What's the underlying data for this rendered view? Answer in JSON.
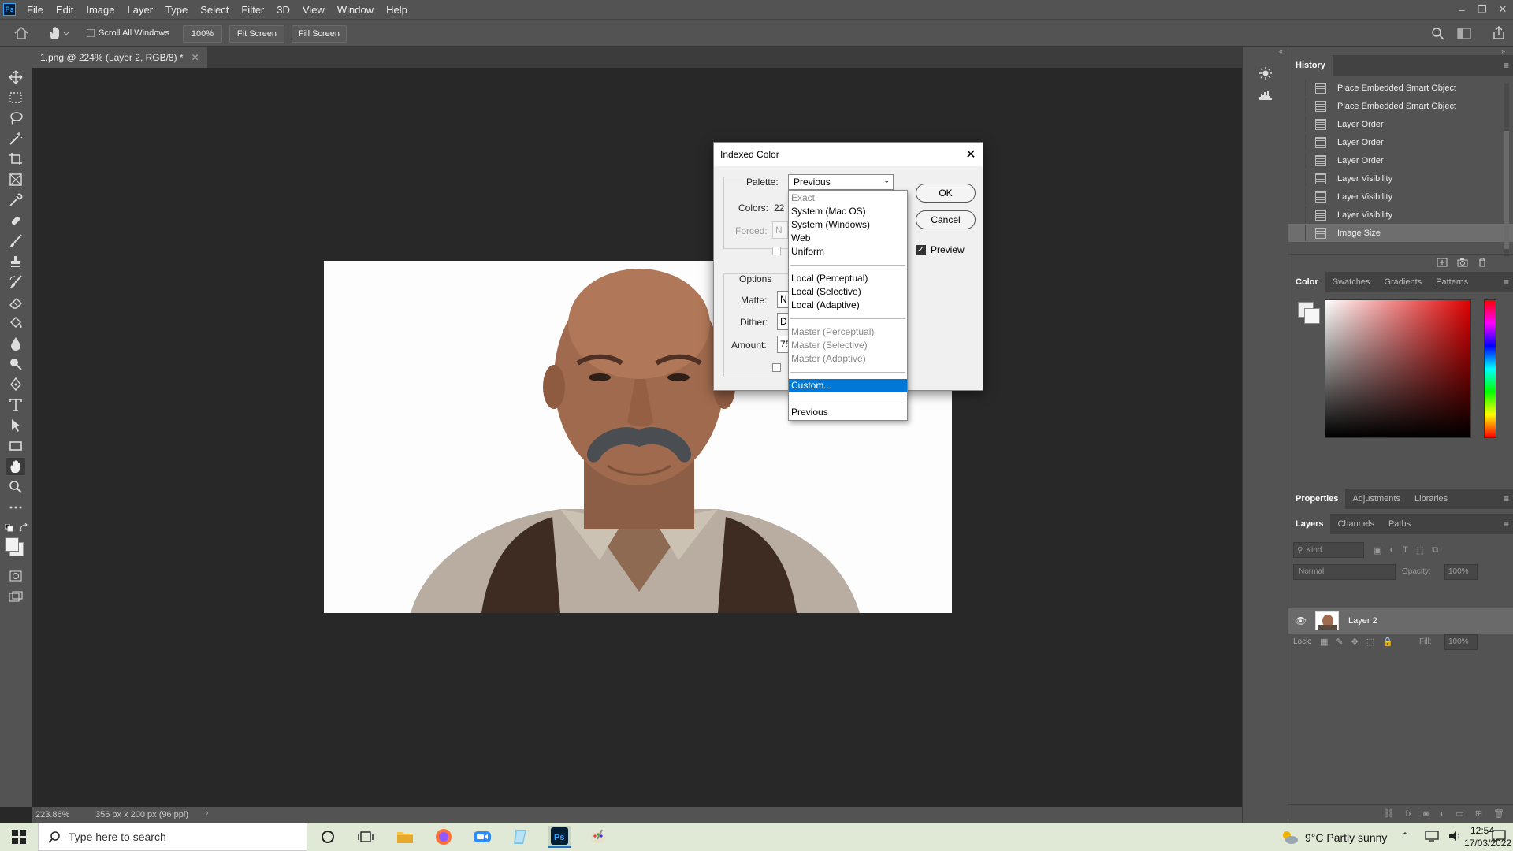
{
  "app": {
    "logo_text": "Ps"
  },
  "menu": [
    "File",
    "Edit",
    "Image",
    "Layer",
    "Type",
    "Select",
    "Filter",
    "3D",
    "View",
    "Window",
    "Help"
  ],
  "options_bar": {
    "scroll_all_windows": "Scroll All Windows",
    "zoom": "100%",
    "fit_screen": "Fit Screen",
    "fill_screen": "Fill Screen"
  },
  "document": {
    "tab_title": "1.png @ 224% (Layer 2, RGB/8) *",
    "status_zoom": "223.86%",
    "status_info": "356 px x 200 px (96 ppi)"
  },
  "history": {
    "title": "History",
    "items": [
      "Place Embedded Smart Object",
      "Place Embedded Smart Object",
      "Layer Order",
      "Layer Order",
      "Layer Order",
      "Layer Visibility",
      "Layer Visibility",
      "Layer Visibility",
      "Image Size"
    ]
  },
  "color_panel": {
    "tabs": [
      "Color",
      "Swatches",
      "Gradients",
      "Patterns"
    ]
  },
  "properties_panel": {
    "tabs": [
      "Properties",
      "Adjustments",
      "Libraries"
    ]
  },
  "layers_panel": {
    "tabs": [
      "Layers",
      "Channels",
      "Paths"
    ],
    "kind_placeholder": "Kind",
    "blend_mode": "Normal",
    "opacity_label": "Opacity:",
    "opacity_value": "100%",
    "lock_label": "Lock:",
    "fill_label": "Fill:",
    "fill_value": "100%",
    "layers": [
      {
        "name": "Layer 2"
      }
    ]
  },
  "dialog": {
    "title": "Indexed Color",
    "palette_label": "Palette:",
    "palette_value": "Previous",
    "colors_label": "Colors:",
    "colors_value": "22",
    "forced_label": "Forced:",
    "forced_value": "N",
    "options_label": "Options",
    "matte_label": "Matte:",
    "matte_value": "N",
    "dither_label": "Dither:",
    "dither_value": "D",
    "amount_label": "Amount:",
    "amount_value": "75",
    "ok": "OK",
    "cancel": "Cancel",
    "preview": "Preview",
    "dropdown": [
      {
        "label": "Exact",
        "state": "disabled"
      },
      {
        "label": "System (Mac OS)",
        "state": "normal"
      },
      {
        "label": "System (Windows)",
        "state": "normal"
      },
      {
        "label": "Web",
        "state": "normal"
      },
      {
        "label": "Uniform",
        "state": "normal"
      },
      {
        "label": "",
        "state": "separator"
      },
      {
        "label": "Local (Perceptual)",
        "state": "normal"
      },
      {
        "label": "Local (Selective)",
        "state": "normal"
      },
      {
        "label": "Local (Adaptive)",
        "state": "normal"
      },
      {
        "label": "",
        "state": "separator"
      },
      {
        "label": "Master (Perceptual)",
        "state": "disabled"
      },
      {
        "label": "Master (Selective)",
        "state": "disabled"
      },
      {
        "label": "Master (Adaptive)",
        "state": "disabled"
      },
      {
        "label": "",
        "state": "separator"
      },
      {
        "label": "Custom...",
        "state": "selected"
      },
      {
        "label": "",
        "state": "separator"
      },
      {
        "label": "Previous",
        "state": "normal"
      }
    ]
  },
  "taskbar": {
    "search_placeholder": "Type here to search",
    "weather": "9°C  Partly sunny",
    "time": "12:54",
    "date": "17/03/2022"
  },
  "colors": {
    "accent": "#0078d7",
    "ps_blue": "#31a8ff"
  }
}
